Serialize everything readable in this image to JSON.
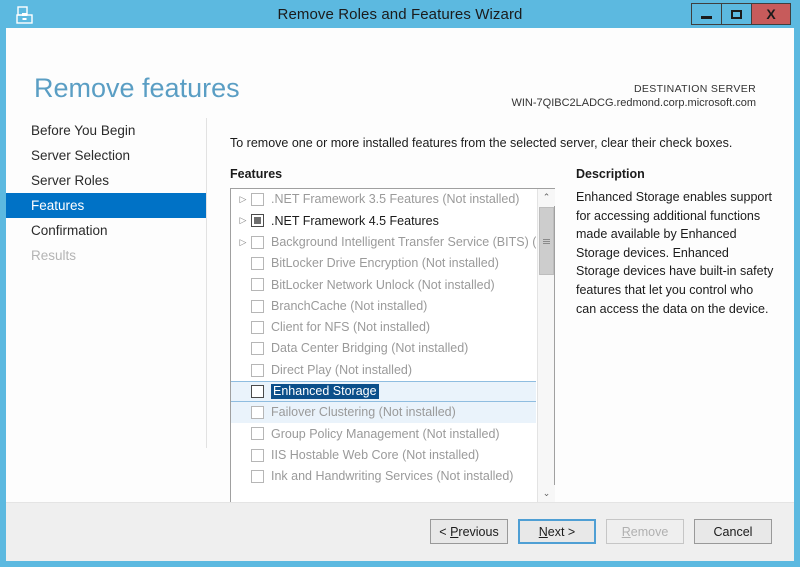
{
  "window": {
    "title": "Remove Roles and Features Wizard",
    "app_icon": "server-manager-icon",
    "minimize_label": "Minimize",
    "maximize_label": "Maximize",
    "close_label": "X"
  },
  "header": {
    "page_title": "Remove features",
    "destination_label": "DESTINATION SERVER",
    "destination_server": "WIN-7QIBC2LADCG.redmond.corp.microsoft.com"
  },
  "sidebar": {
    "items": [
      {
        "label": "Before You Begin",
        "state": "normal"
      },
      {
        "label": "Server Selection",
        "state": "normal"
      },
      {
        "label": "Server Roles",
        "state": "normal"
      },
      {
        "label": "Features",
        "state": "active"
      },
      {
        "label": "Confirmation",
        "state": "normal"
      },
      {
        "label": "Results",
        "state": "disabled"
      }
    ]
  },
  "main": {
    "instruction": "To remove one or more installed features from the selected server, clear their check boxes.",
    "features_label": "Features",
    "description_label": "Description",
    "features": [
      {
        "label": ".NET Framework 3.5 Features (Not installed)",
        "expander": true,
        "checkbox": "unchecked",
        "installed": false,
        "selected": false,
        "hover": false
      },
      {
        "label": ".NET Framework 4.5 Features",
        "expander": true,
        "checkbox": "partial",
        "installed": true,
        "selected": false,
        "hover": false
      },
      {
        "label": "Background Intelligent Transfer Service (BITS) (No",
        "expander": true,
        "checkbox": "unchecked",
        "installed": false,
        "selected": false,
        "hover": false
      },
      {
        "label": "BitLocker Drive Encryption (Not installed)",
        "expander": false,
        "checkbox": "unchecked",
        "installed": false,
        "selected": false,
        "hover": false
      },
      {
        "label": "BitLocker Network Unlock (Not installed)",
        "expander": false,
        "checkbox": "unchecked",
        "installed": false,
        "selected": false,
        "hover": false
      },
      {
        "label": "BranchCache (Not installed)",
        "expander": false,
        "checkbox": "unchecked",
        "installed": false,
        "selected": false,
        "hover": false
      },
      {
        "label": "Client for NFS (Not installed)",
        "expander": false,
        "checkbox": "unchecked",
        "installed": false,
        "selected": false,
        "hover": false
      },
      {
        "label": "Data Center Bridging (Not installed)",
        "expander": false,
        "checkbox": "unchecked",
        "installed": false,
        "selected": false,
        "hover": false
      },
      {
        "label": "Direct Play (Not installed)",
        "expander": false,
        "checkbox": "unchecked",
        "installed": false,
        "selected": false,
        "hover": false
      },
      {
        "label": "Enhanced Storage",
        "expander": false,
        "checkbox": "unchecked",
        "installed": true,
        "selected": true,
        "hover": false
      },
      {
        "label": "Failover Clustering (Not installed)",
        "expander": false,
        "checkbox": "unchecked",
        "installed": false,
        "selected": false,
        "hover": true
      },
      {
        "label": "Group Policy Management (Not installed)",
        "expander": false,
        "checkbox": "unchecked",
        "installed": false,
        "selected": false,
        "hover": false
      },
      {
        "label": "IIS Hostable Web Core (Not installed)",
        "expander": false,
        "checkbox": "unchecked",
        "installed": false,
        "selected": false,
        "hover": false
      },
      {
        "label": "Ink and Handwriting Services (Not installed)",
        "expander": false,
        "checkbox": "unchecked",
        "installed": false,
        "selected": false,
        "hover": false
      }
    ],
    "description_text": "Enhanced Storage enables support for accessing additional functions made available by Enhanced Storage devices. Enhanced Storage devices have built-in safety features that let you control who can access the data on the device."
  },
  "scrollbars": {
    "up_arrow": "⌃",
    "down_arrow": "⌄",
    "left_arrow": "‹",
    "right_arrow": "›"
  },
  "footer": {
    "previous": {
      "prefix": "< ",
      "accel": "P",
      "rest": "revious",
      "state": "normal"
    },
    "next": {
      "prefix": "",
      "accel": "N",
      "rest": "ext >",
      "state": "focused"
    },
    "remove": {
      "prefix": "",
      "accel": "R",
      "rest": "emove",
      "state": "disabled"
    },
    "cancel": {
      "prefix": "",
      "accel": "",
      "rest": "Cancel",
      "state": "normal"
    }
  },
  "colors": {
    "frame_blue": "#5cb9e0",
    "accent_blue": "#0072c6",
    "title_blue": "#5a9ec4",
    "close_red": "#c75b5b",
    "selection_blue": "#0b4f8a",
    "row_hover": "#eaf3fb"
  }
}
